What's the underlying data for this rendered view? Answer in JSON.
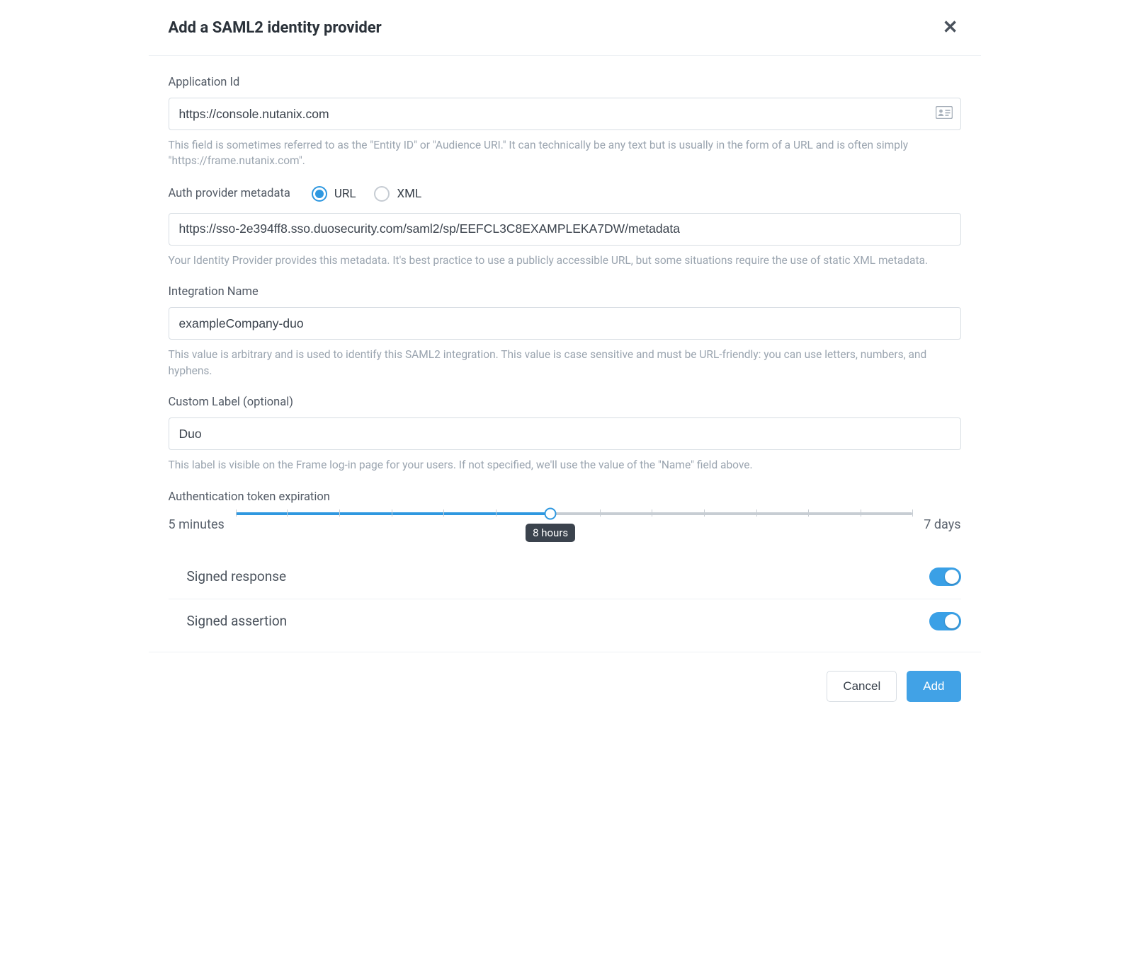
{
  "header": {
    "title": "Add a SAML2 identity provider"
  },
  "fields": {
    "application_id": {
      "label": "Application Id",
      "value": "https://console.nutanix.com",
      "help": "This field is sometimes referred to as the \"Entity ID\" or \"Audience URI.\" It can technically be any text but is usually in the form of a URL and is often simply \"https://frame.nutanix.com\"."
    },
    "metadata": {
      "label": "Auth provider metadata",
      "option_url": "URL",
      "option_xml": "XML",
      "value": "https://sso-2e394ff8.sso.duosecurity.com/saml2/sp/EEFCL3C8EXAMPLEKA7DW/metadata",
      "help": "Your Identity Provider provides this metadata. It's best practice to use a publicly accessible URL, but some situations require the use of static XML metadata."
    },
    "integration_name": {
      "label": "Integration Name",
      "value": "exampleCompany-duo",
      "help": "This value is arbitrary and is used to identify this SAML2 integration. This value is case sensitive and must be URL-friendly: you can use letters, numbers, and hyphens."
    },
    "custom_label": {
      "label": "Custom Label (optional)",
      "value": "Duo",
      "help": "This label is visible on the Frame log-in page for your users. If not specified, we'll use the value of the \"Name\" field above."
    },
    "token_expiration": {
      "label": "Authentication token expiration",
      "min_caption": "5 minutes",
      "max_caption": "7 days",
      "current_caption": "8 hours"
    },
    "signed_response": {
      "label": "Signed response",
      "on": true
    },
    "signed_assertion": {
      "label": "Signed assertion",
      "on": true
    }
  },
  "footer": {
    "cancel": "Cancel",
    "add": "Add"
  }
}
